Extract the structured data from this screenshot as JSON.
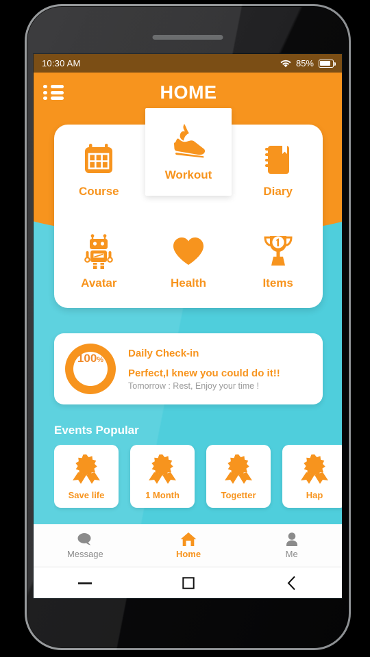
{
  "status_bar": {
    "time": "10:30 AM",
    "wifi_icon": "wifi-icon",
    "battery_percent": "85%",
    "battery_icon": "battery-icon"
  },
  "header": {
    "menu_icon": "list-menu-icon",
    "title": "HOME"
  },
  "menu_grid": {
    "tiles": [
      {
        "label": "Course",
        "icon": "calendar-icon",
        "selected": false
      },
      {
        "label": "Workout",
        "icon": "running-shoe-icon",
        "selected": true
      },
      {
        "label": "Diary",
        "icon": "notebook-icon",
        "selected": false
      },
      {
        "label": "Avatar",
        "icon": "robot-icon",
        "selected": false
      },
      {
        "label": "Health",
        "icon": "heart-icon",
        "selected": false
      },
      {
        "label": "Items",
        "icon": "trophy-icon",
        "selected": false
      }
    ]
  },
  "check_in": {
    "progress_value": "100",
    "progress_unit": "%",
    "title": "Daily Check-in",
    "message": "Perfect,I knew you could do it!!",
    "sub_message": "Tomorrow : Rest, Enjoy your time !"
  },
  "events": {
    "section_title": "Events Popular",
    "cards": [
      {
        "label": "Save life",
        "icon": "award-ribbon-icon"
      },
      {
        "label": "1 Month",
        "icon": "award-ribbon-icon"
      },
      {
        "label": "Togetter",
        "icon": "award-ribbon-icon"
      },
      {
        "label": "Hap",
        "icon": "award-ribbon-icon"
      }
    ]
  },
  "bottom_nav": {
    "items": [
      {
        "label": "Message",
        "icon": "chat-bubble-icon",
        "active": false
      },
      {
        "label": "Home",
        "icon": "house-icon",
        "active": true
      },
      {
        "label": "Me",
        "icon": "person-icon",
        "active": false
      }
    ]
  },
  "system_bar": {
    "buttons": [
      {
        "name": "minimize-button",
        "icon": "dash-icon"
      },
      {
        "name": "recents-button",
        "icon": "square-icon"
      },
      {
        "name": "back-button",
        "icon": "chevron-left-icon"
      }
    ]
  },
  "colors": {
    "accent_orange": "#f7941e",
    "background_cyan": "#4fcedc",
    "status_bar": "#7b4e15",
    "card_white": "#ffffff",
    "muted_gray": "#8b8b8b"
  }
}
